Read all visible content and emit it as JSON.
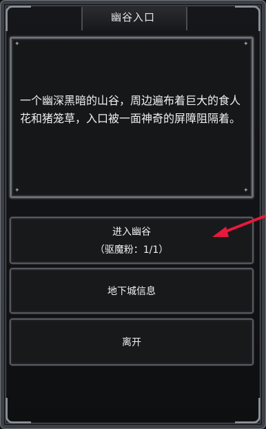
{
  "window": {
    "title": "幽谷入口"
  },
  "description": {
    "text": "一个幽深黑暗的山谷，周边遍布着巨大的食人花和猪笼草，入口被一面神奇的屏障阻隔着。"
  },
  "actions": {
    "enter_label": "进入幽谷",
    "enter_cost": "（驱魔粉：1/1）",
    "dungeon_info_label": "地下城信息",
    "leave_label": "离开"
  },
  "colors": {
    "annotation_arrow": "#e8193c",
    "frame": "#6c7077",
    "text": "#f0f0f0"
  }
}
